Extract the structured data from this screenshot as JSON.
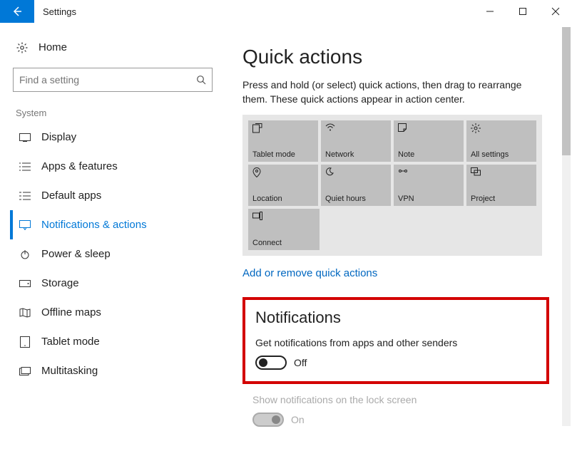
{
  "window": {
    "title": "Settings"
  },
  "sidebar": {
    "home": "Home",
    "search_placeholder": "Find a setting",
    "group": "System",
    "items": [
      {
        "label": "Display"
      },
      {
        "label": "Apps & features"
      },
      {
        "label": "Default apps"
      },
      {
        "label": "Notifications & actions"
      },
      {
        "label": "Power & sleep"
      },
      {
        "label": "Storage"
      },
      {
        "label": "Offline maps"
      },
      {
        "label": "Tablet mode"
      },
      {
        "label": "Multitasking"
      }
    ]
  },
  "main": {
    "quick_title": "Quick actions",
    "quick_desc": "Press and hold (or select) quick actions, then drag to rearrange them. These quick actions appear in action center.",
    "tiles": [
      [
        {
          "label": "Tablet mode"
        },
        {
          "label": "Network"
        },
        {
          "label": "Note"
        },
        {
          "label": "All settings"
        }
      ],
      [
        {
          "label": "Location"
        },
        {
          "label": "Quiet hours"
        },
        {
          "label": "VPN"
        },
        {
          "label": "Project"
        }
      ],
      [
        {
          "label": "Connect"
        }
      ]
    ],
    "link": "Add or remove quick actions",
    "notif_title": "Notifications",
    "notif_setting_label": "Get notifications from apps and other senders",
    "notif_state": "Off",
    "lock_label": "Show notifications on the lock screen",
    "lock_state": "On"
  }
}
